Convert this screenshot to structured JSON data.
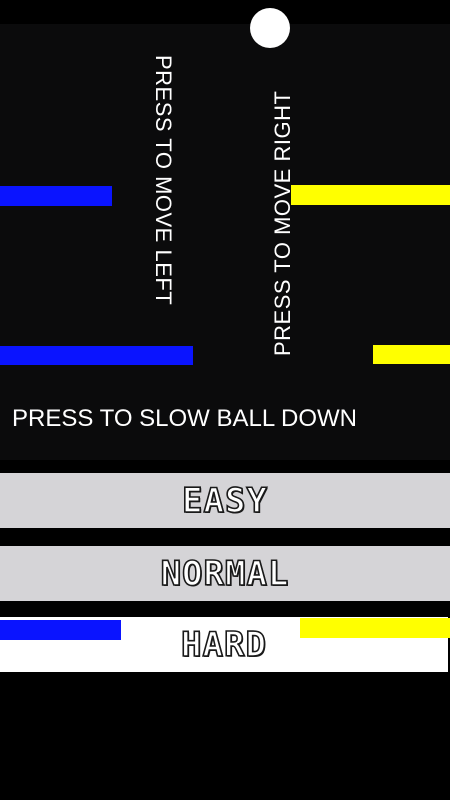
{
  "instructions": {
    "left": "PRESS TO MOVE LEFT",
    "right": "PRESS TO MOVE RIGHT",
    "slow": "PRESS TO SLOW BALL DOWN"
  },
  "difficulty": {
    "easy": "EASY",
    "normal": "NORMAL",
    "hard": "HARD"
  },
  "colors": {
    "left_bar": "#0a14ff",
    "right_bar": "#ffff00",
    "ball": "#ffffff",
    "button_bg": "#d5d4d7"
  }
}
